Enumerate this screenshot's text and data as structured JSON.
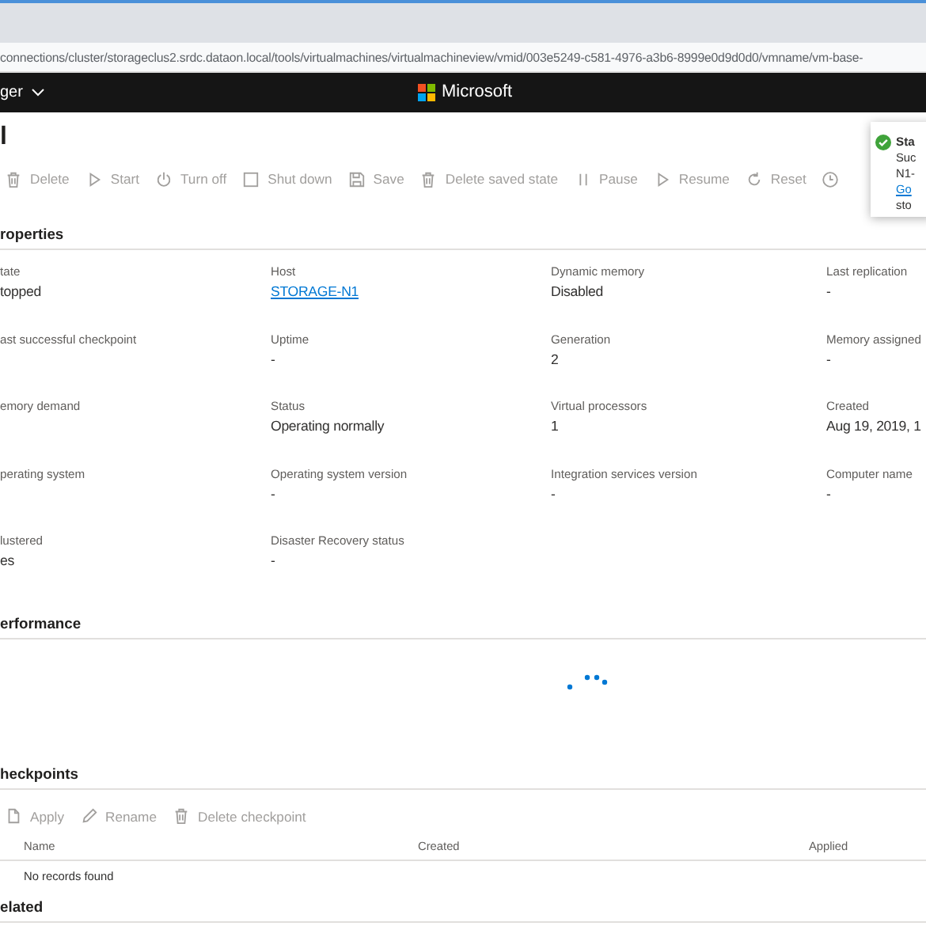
{
  "browser": {
    "address": "connections/cluster/storageclus2.srdc.dataon.local/tools/virtualmachines/virtualmachineview/vmid/003e5249-c581-4976-a3b6-8999e0d9d0d0/vmname/vm-base-"
  },
  "header": {
    "app_menu": "ger",
    "brand": "Microsoft"
  },
  "title": "l",
  "toolbar": [
    {
      "label": "Delete",
      "kind": "trash",
      "disabled": true
    },
    {
      "label": "Start",
      "kind": "play",
      "disabled": true
    },
    {
      "label": "Turn off",
      "kind": "power",
      "disabled": true
    },
    {
      "label": "Shut down",
      "kind": "square",
      "disabled": true
    },
    {
      "label": "Save",
      "kind": "save",
      "disabled": true
    },
    {
      "label": "Delete saved state",
      "kind": "trash",
      "disabled": true
    },
    {
      "label": "Pause",
      "kind": "pause",
      "disabled": true
    },
    {
      "label": "Resume",
      "kind": "play",
      "disabled": true
    },
    {
      "label": "Reset",
      "kind": "reset",
      "disabled": true
    },
    {
      "kind": "clock",
      "disabled": true
    }
  ],
  "properties": {
    "heading": "roperties",
    "items": [
      {
        "label": "tate",
        "value": "topped"
      },
      {
        "label": "Host",
        "value": "STORAGE-N1",
        "kind": "link"
      },
      {
        "label": "Dynamic memory",
        "value": "Disabled"
      },
      {
        "label": "Last replication",
        "value": "-"
      },
      {
        "label": "ast successful checkpoint"
      },
      {
        "label": "Uptime",
        "value": "-"
      },
      {
        "label": "Generation",
        "value": "2"
      },
      {
        "label": "Memory assigned",
        "value": "-"
      },
      {
        "label": "emory demand"
      },
      {
        "label": "Status",
        "value": "Operating normally"
      },
      {
        "label": "Virtual processors",
        "value": "1"
      },
      {
        "label": "Created",
        "value": "Aug 19, 2019, 1"
      },
      {
        "label": "perating system"
      },
      {
        "label": "Operating system version",
        "value": "-"
      },
      {
        "label": "Integration services version",
        "value": "-"
      },
      {
        "label": "Computer name",
        "value": "-"
      },
      {
        "label": "lustered",
        "value": "es"
      },
      {
        "label": "Disaster Recovery status",
        "value": "-"
      }
    ]
  },
  "performance": {
    "heading": "erformance"
  },
  "checkpoints": {
    "heading": "heckpoints",
    "toolbar": [
      {
        "label": "Apply",
        "kind": "doc",
        "disabled": true
      },
      {
        "label": "Rename",
        "kind": "pencil",
        "disabled": true
      },
      {
        "label": "Delete checkpoint",
        "kind": "trash",
        "disabled": true
      }
    ],
    "columns": [
      "Name",
      "Created",
      "Applied"
    ],
    "empty": "No records found"
  },
  "related": {
    "heading": "elated"
  },
  "toast": {
    "title": "Sta",
    "lines": [
      "Suc",
      "N1-"
    ],
    "link": "Go",
    "footer": "sto"
  }
}
